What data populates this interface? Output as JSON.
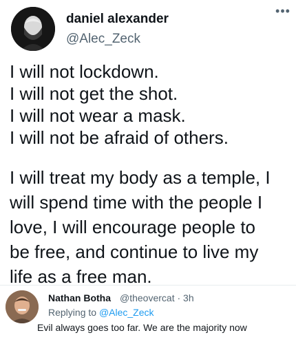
{
  "tweet": {
    "author_name": "daniel alexander",
    "author_handle": "@Alec_Zeck",
    "more_icon": "more-horizontal-icon",
    "paragraph1": [
      "I will not lockdown.",
      "I will not get the shot.",
      "I will not wear a mask.",
      "I will not be afraid of others."
    ],
    "paragraph2": [
      "I will treat my body as a temple, I",
      "will spend time with the people I",
      "love, I will encourage people to",
      "be free, and continue to live my",
      "life as a free man."
    ]
  },
  "reply": {
    "author_name": "Nathan Botha",
    "author_handle": "@theovercat",
    "separator": "·",
    "time": "3h",
    "replying_prefix": "Replying to",
    "replying_to": "@Alec_Zeck",
    "text": "Evil always goes too far. We are the majority now"
  }
}
